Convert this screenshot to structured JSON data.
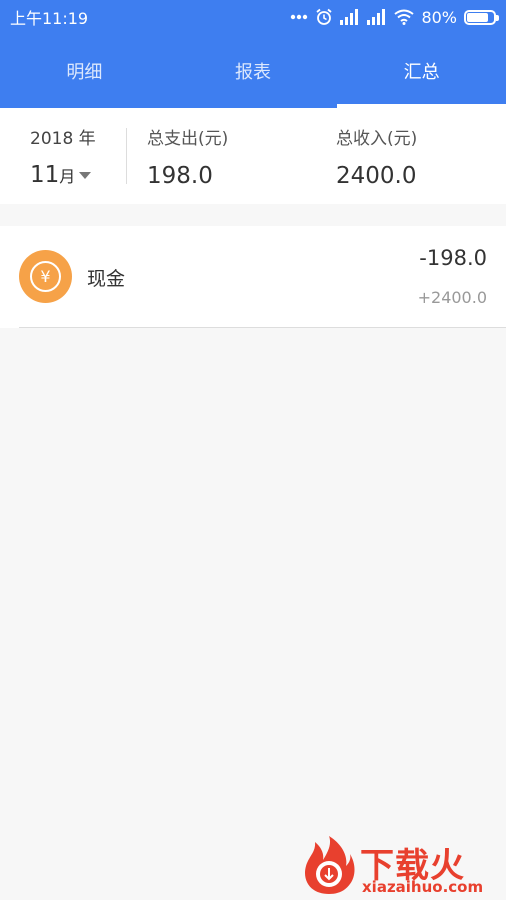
{
  "status_bar": {
    "time": "上午11:19",
    "battery": "80%",
    "battery_level": 0.8,
    "icons": [
      "more-dots-icon",
      "alarm-icon",
      "signal-icon",
      "signal-icon",
      "wifi-icon",
      "battery-icon"
    ]
  },
  "colors": {
    "primary": "#3e7ef0",
    "account_icon": "#f6a248",
    "watermark": "#e8402e"
  },
  "tabs": [
    {
      "label": "明细",
      "active": false
    },
    {
      "label": "报表",
      "active": false
    },
    {
      "label": "汇总",
      "active": true
    }
  ],
  "summary": {
    "year": "2018 年",
    "month": "11",
    "month_unit": "月",
    "expense_label": "总支出(元)",
    "expense_value": "198.0",
    "income_label": "总收入(元)",
    "income_value": "2400.0"
  },
  "accounts": [
    {
      "icon": "yuan-icon",
      "icon_symbol": "¥",
      "name": "现金",
      "expense": "-198.0",
      "income": "+2400.0"
    }
  ],
  "watermark": {
    "title": "下载火",
    "subtitle": "xiazaihuo.com"
  }
}
